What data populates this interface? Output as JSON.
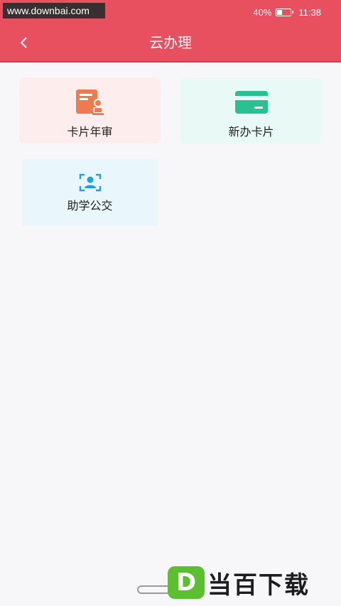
{
  "status_bar": {
    "watermark": "www.downbai.com",
    "battery": "40%",
    "battery_level": 0.4,
    "time": "11:38"
  },
  "header": {
    "title": "云办理"
  },
  "cards": [
    {
      "label": "卡片年审",
      "icon": "id-card-stamp-icon",
      "color": "#f07a4f",
      "bg": "#fdeeed"
    },
    {
      "label": "新办卡片",
      "icon": "credit-card-icon",
      "color": "#2bbf94",
      "bg": "#e9f9f5"
    },
    {
      "label": "助学公交",
      "icon": "face-scan-icon",
      "color": "#21a3d8",
      "bg": "#e9f7fc"
    }
  ],
  "watermark_bottom": {
    "logo": "D",
    "text": "当百下载"
  },
  "colors": {
    "header": "#e85060",
    "background": "#f7f7f9"
  }
}
